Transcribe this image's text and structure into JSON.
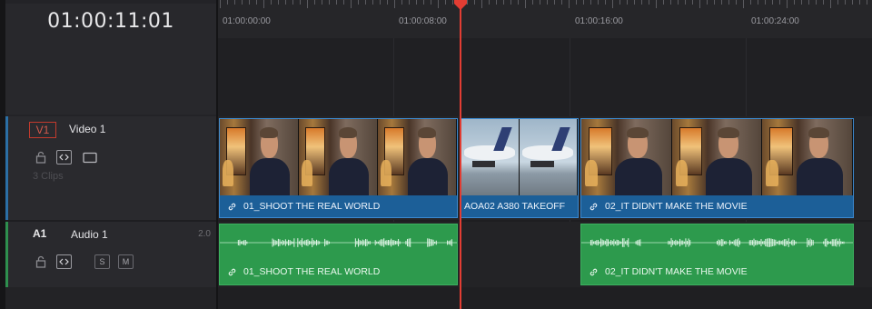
{
  "timecode": "01:00:11:01",
  "ruler": {
    "labels": [
      "01:00:00:00",
      "01:00:08:00",
      "01:00:16:00",
      "01:00:24:00"
    ]
  },
  "video_track": {
    "badge": "V1",
    "name": "Video 1",
    "clip_count": "3 Clips",
    "accent_color": "#2b6fa6",
    "clips": [
      {
        "name": "01_SHOOT THE REAL WORLD",
        "linked": true
      },
      {
        "name": "AOA02 A380 TAKEOFF",
        "linked": false
      },
      {
        "name": "02_IT DIDN'T MAKE THE MOVIE",
        "linked": true
      }
    ]
  },
  "audio_track": {
    "badge": "A1",
    "name": "Audio 1",
    "level": "2.0",
    "solo_label": "S",
    "mute_label": "M",
    "accent_color": "#2e8f4e",
    "clips": [
      {
        "name": "01_SHOOT THE REAL WORLD",
        "linked": true
      },
      {
        "name": "02_IT DIDN'T MAKE THE MOVIE",
        "linked": true
      }
    ]
  },
  "playhead_color": "#e23d33",
  "video_clip_color": "#1f6aa8",
  "audio_clip_color": "#2d9a4d"
}
